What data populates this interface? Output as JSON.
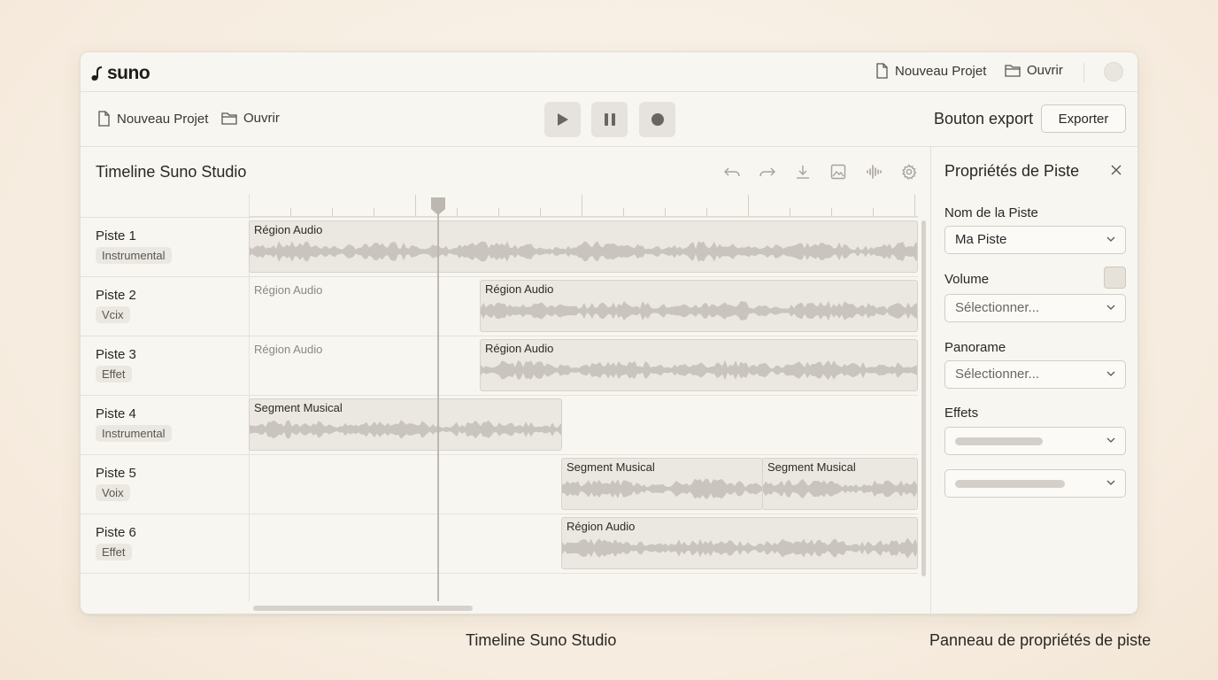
{
  "app": {
    "logo_text": "suno",
    "titlebar_new": "Nouveau Projet",
    "titlebar_open": "Ouvrir"
  },
  "toolbar": {
    "new_label": "Nouveau Projet",
    "open_label": "Ouvrir",
    "export_heading": "Bouton export",
    "export_button": "Exporter"
  },
  "timeline": {
    "title": "Timeline Suno Studio",
    "tracks": [
      {
        "name": "Piste 1",
        "tag": "Instrumental"
      },
      {
        "name": "Piste 2",
        "tag": "Vcix"
      },
      {
        "name": "Piste 3",
        "tag": "Effet"
      },
      {
        "name": "Piste 4",
        "tag": "Instrumental"
      },
      {
        "name": "Piste 5",
        "tag": "Voix"
      },
      {
        "name": "Piste 6",
        "tag": "Effet"
      }
    ],
    "regions": [
      {
        "label": "Région Audio"
      },
      {
        "label": "Région Audio"
      },
      {
        "label": "Région Audio"
      },
      {
        "label": "Segment Musical"
      },
      {
        "label": "Segment Musical"
      },
      {
        "label": "Segment Musical"
      },
      {
        "label": "Région Audio"
      }
    ],
    "ghost_labels": [
      "Région Audio",
      "Région Audio"
    ]
  },
  "panel": {
    "title": "Propriétés de Piste",
    "name_label": "Nom de la Piste",
    "name_value": "Ma Piste",
    "volume_label": "Volume",
    "volume_placeholder": "Sélectionner...",
    "pan_label": "Panorame",
    "pan_placeholder": "Sélectionner...",
    "effects_label": "Effets"
  },
  "captions": {
    "timeline": "Timeline Suno Studio",
    "panel": "Panneau de propriétés de piste"
  },
  "colors": {
    "background": "#f6ecdf",
    "window": "#f8f6f1",
    "region": "#ebe8e2",
    "waveform": "#c9c5be"
  }
}
